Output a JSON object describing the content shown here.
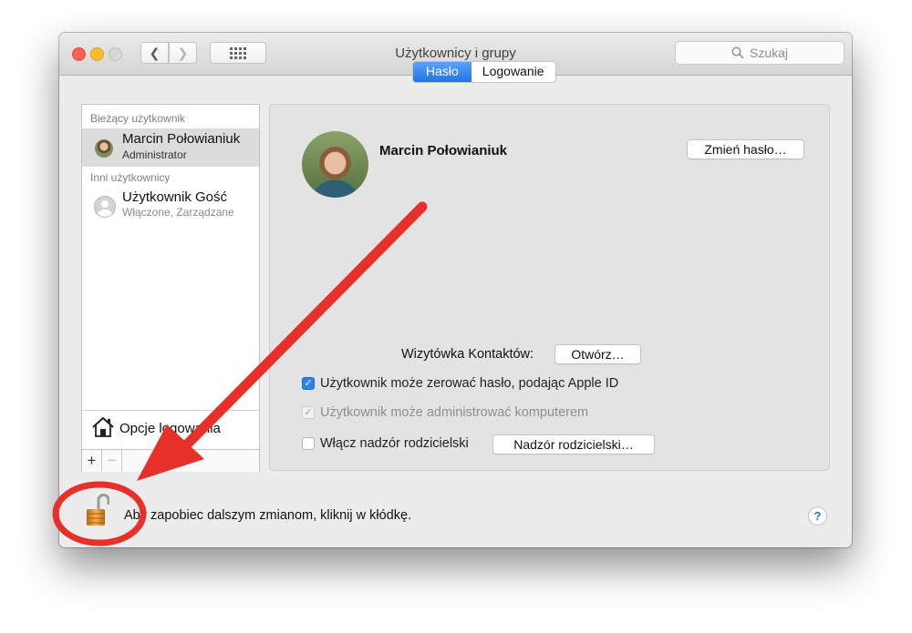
{
  "window": {
    "title": "Użytkownicy i grupy"
  },
  "search": {
    "placeholder": "Szukaj"
  },
  "tabs": [
    {
      "label": "Hasło",
      "active": true
    },
    {
      "label": "Logowanie",
      "active": false
    }
  ],
  "sidebar": {
    "current_header": "Bieżący użytkownik",
    "others_header": "Inni użytkownicy",
    "users": [
      {
        "name": "Marcin Połowianiuk",
        "role": "Administrator",
        "selected": true
      },
      {
        "name": "Użytkownik Gość",
        "role": "Włączone, Zarządzane",
        "selected": false
      }
    ],
    "login_options_label": "Opcje logowania",
    "add_label": "+",
    "remove_label": "−"
  },
  "main": {
    "user_name": "Marcin Połowianiuk",
    "change_password_label": "Zmień hasło…",
    "contact_card_label": "Wizytówka Kontaktów:",
    "open_label": "Otwórz…",
    "checkboxes": [
      {
        "label": "Użytkownik może zerować hasło, podając Apple ID",
        "checked": true,
        "enabled": true
      },
      {
        "label": "Użytkownik może administrować komputerem",
        "checked": true,
        "enabled": false
      },
      {
        "label": "Włącz nadzór rodzicielski",
        "checked": false,
        "enabled": true
      }
    ],
    "parental_controls_label": "Nadzór rodzicielski…"
  },
  "footer": {
    "lock_message": "Aby zapobiec dalszym zmianom, kliknij w kłódkę.",
    "help_label": "?"
  },
  "colors": {
    "accent": "#2f80f0",
    "annotation": "#e8302a"
  }
}
